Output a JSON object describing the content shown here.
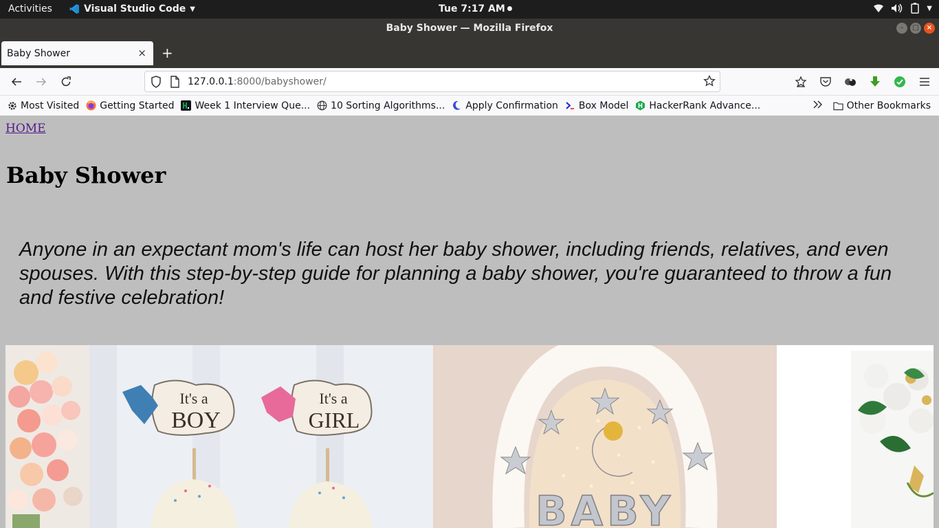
{
  "topbar": {
    "activities": "Activities",
    "app_name": "Visual Studio Code",
    "clock": "Tue  7:17 AM"
  },
  "window": {
    "title": "Baby Shower — Mozilla Firefox"
  },
  "tab": {
    "label": "Baby Shower",
    "close": "×",
    "new_tab": "+"
  },
  "urlbar": {
    "host": "127.0.0.1",
    "path": ":8000/babyshower/"
  },
  "bookmarks": {
    "items": [
      {
        "label": "Most Visited",
        "icon": "gear-icon"
      },
      {
        "label": "Getting Started",
        "icon": "firefox-icon"
      },
      {
        "label": "Week 1 Interview Que...",
        "icon": "hackerrank-dark-icon"
      },
      {
        "label": "10 Sorting Algorithms...",
        "icon": "globe-icon"
      },
      {
        "label": "Apply Confirmation",
        "icon": "moon-icon"
      },
      {
        "label": "Box Model",
        "icon": "terminal-icon"
      },
      {
        "label": "HackerRank Advance...",
        "icon": "hackerrank-green-icon"
      }
    ],
    "other": "Other Bookmarks"
  },
  "page": {
    "home_link": "HOME",
    "title": "Baby Shower",
    "intro": "Anyone in an expectant mom's life can host her baby shower, including friends, relatives, and even spouses. With this step-by-step guide for planning a baby shower, you're guaranteed to throw a fun and festive celebration!",
    "images": {
      "cupcake_left_topper_line1": "It's a",
      "cupcake_left_topper_line2": "BOY",
      "cupcake_right_topper_line1": "It's a",
      "cupcake_right_topper_line2": "GIRL",
      "balloon_letters": "BABY"
    }
  },
  "colors": {
    "page_bg": "#bebebe",
    "link_visited": "#551a8b",
    "ubuntu_orange": "#e95420",
    "vscode_blue": "#2489ca"
  }
}
